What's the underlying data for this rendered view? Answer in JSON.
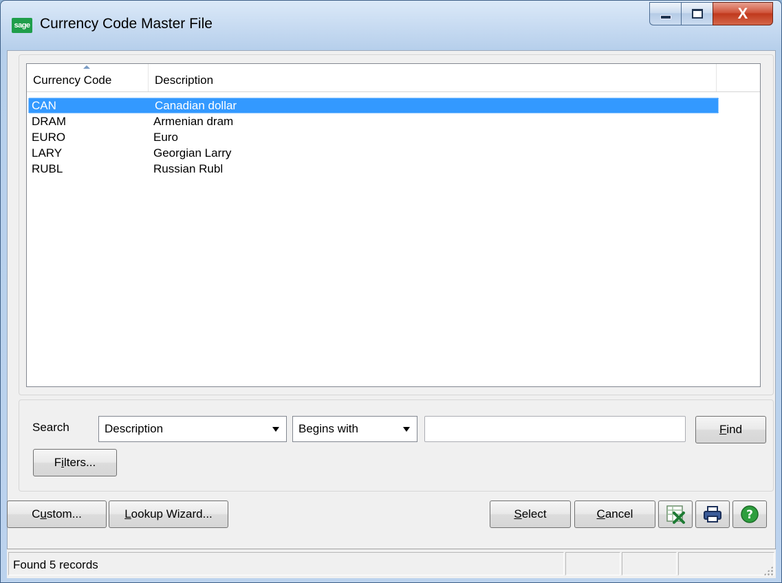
{
  "window": {
    "title": "Currency Code Master File",
    "app_icon_text": "sage"
  },
  "caption_buttons": {
    "close_glyph": "X"
  },
  "list": {
    "columns": [
      "Currency Code",
      "Description"
    ],
    "rows": [
      {
        "code": "CAN",
        "description": "Canadian dollar",
        "selected": true
      },
      {
        "code": "DRAM",
        "description": "Armenian dram",
        "selected": false
      },
      {
        "code": "EURO",
        "description": "Euro",
        "selected": false
      },
      {
        "code": "LARY",
        "description": "Georgian Larry",
        "selected": false
      },
      {
        "code": "RUBL",
        "description": "Russian Rubl",
        "selected": false
      }
    ]
  },
  "search": {
    "label": "Search",
    "field_value": "Description",
    "operator_value": "Begins with",
    "text_value": "",
    "find_label_u": "F",
    "find_label_rest": "ind",
    "filters_label_pre": "F",
    "filters_label_u": "i",
    "filters_label_rest": "lters..."
  },
  "toolbar": {
    "custom_pre": "C",
    "custom_u": "u",
    "custom_rest": "stom...",
    "wizard_u": "L",
    "wizard_rest": "ookup Wizard...",
    "select_u": "S",
    "select_rest": "elect",
    "cancel_u": "C",
    "cancel_rest": "ancel"
  },
  "status": {
    "message": "Found 5 records"
  },
  "colors": {
    "selection": "#3399ff",
    "excel_green": "#1e7b34",
    "help_green": "#2e9e3e"
  }
}
